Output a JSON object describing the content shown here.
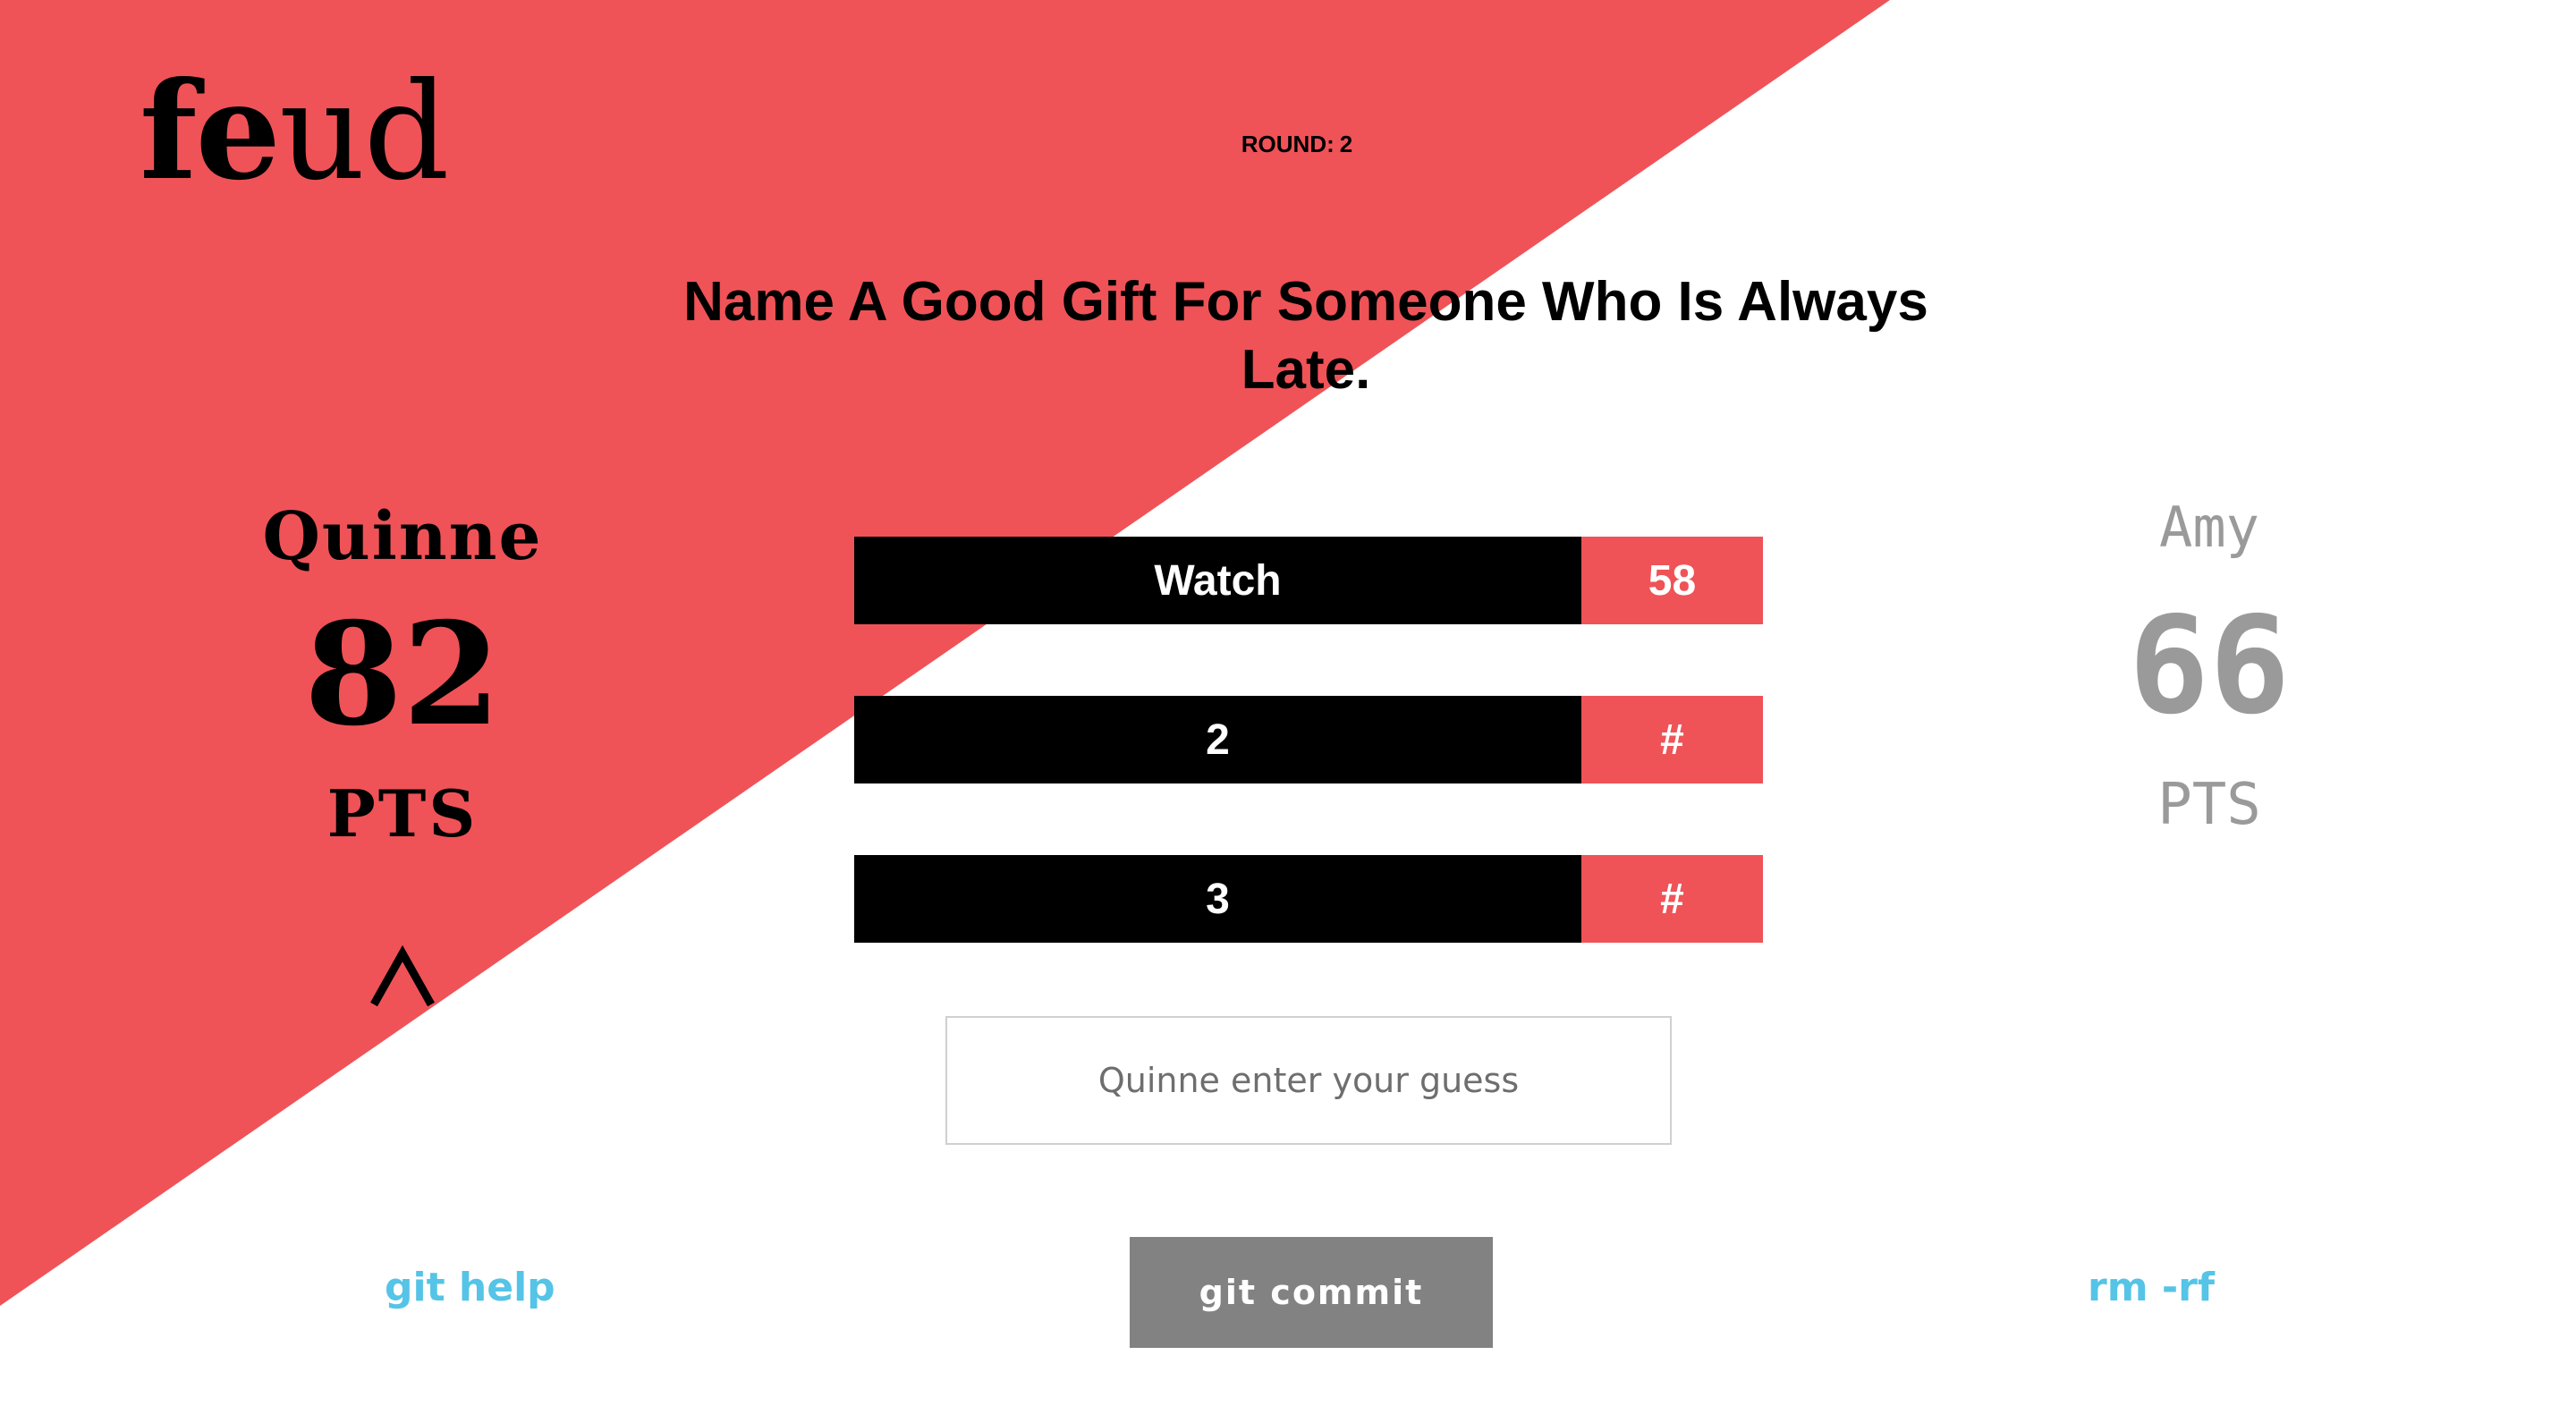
{
  "app": {
    "logo_part1": "fe",
    "logo_part2": "ud",
    "round_label": "ROUND:",
    "round_number": "2",
    "accent_color": "#ef5357"
  },
  "question": "Name A Good Gift For Someone Who Is Always Late.",
  "players": [
    {
      "name": "Quinne",
      "score": "82",
      "unit": "PTS",
      "active": true
    },
    {
      "name": "Amy",
      "score": "66",
      "unit": "PTS",
      "active": false
    }
  ],
  "active_indicator_icon": "caret-up-icon",
  "answers": [
    {
      "text": "Watch",
      "points": "58"
    },
    {
      "text": "2",
      "points": "#"
    },
    {
      "text": "3",
      "points": "#"
    }
  ],
  "guess": {
    "placeholder": "Quinne enter your guess",
    "value": ""
  },
  "actions": {
    "help": "git help",
    "submit": "git commit",
    "reset": "rm -rf"
  }
}
